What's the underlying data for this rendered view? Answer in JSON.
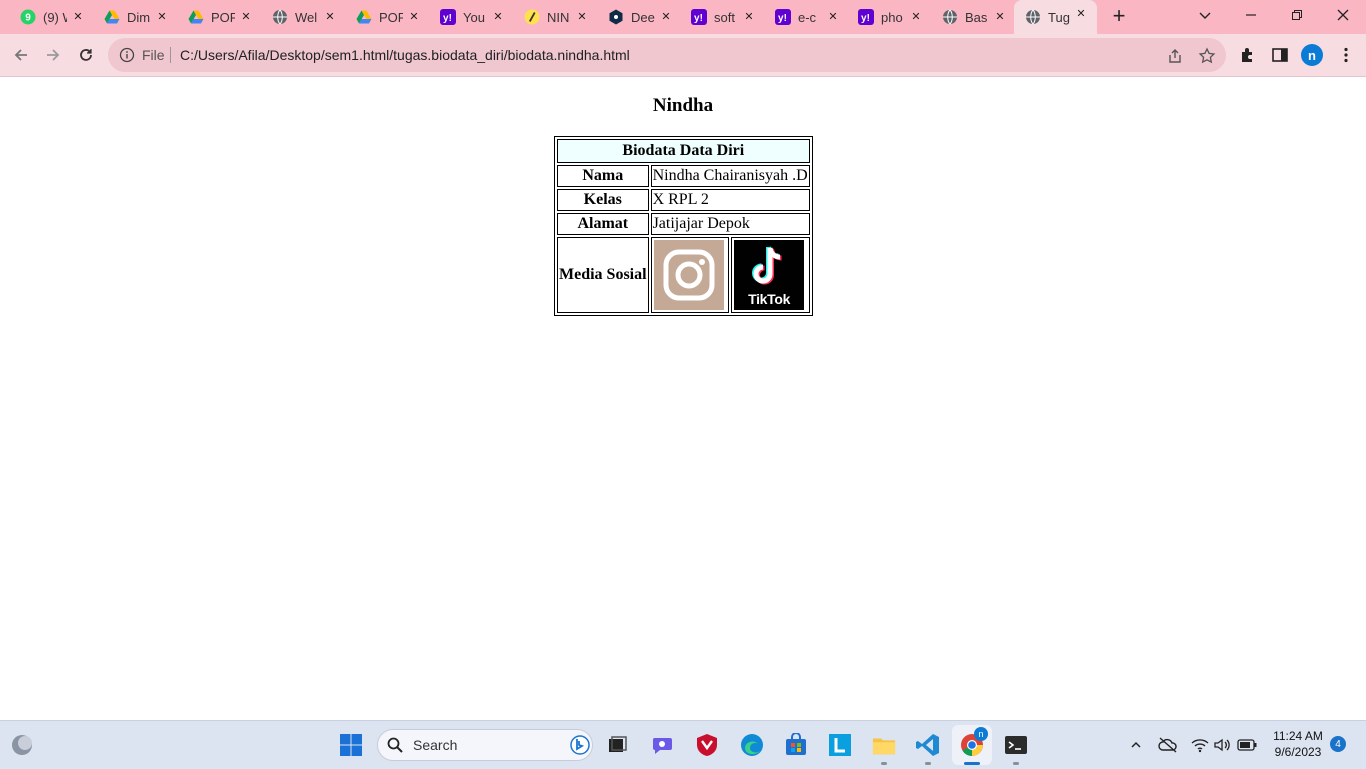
{
  "browser": {
    "tabs": [
      {
        "title": "(9) W",
        "icon": "whatsapp-icon",
        "active": false
      },
      {
        "title": "Dim",
        "icon": "google-drive-icon",
        "active": false
      },
      {
        "title": "POF",
        "icon": "google-drive-icon",
        "active": false
      },
      {
        "title": "Wel",
        "icon": "globe-icon",
        "active": false
      },
      {
        "title": "POF",
        "icon": "google-drive-icon",
        "active": false
      },
      {
        "title": "You",
        "icon": "yahoo-icon",
        "active": false
      },
      {
        "title": "NIN",
        "icon": "pencil-icon",
        "active": false
      },
      {
        "title": "Dee",
        "icon": "deepl-icon",
        "active": false
      },
      {
        "title": "soft",
        "icon": "yahoo-icon",
        "active": false
      },
      {
        "title": "e-c",
        "icon": "yahoo-icon",
        "active": false
      },
      {
        "title": "pho",
        "icon": "yahoo-icon",
        "active": false
      },
      {
        "title": "Bas",
        "icon": "globe-icon",
        "active": false
      },
      {
        "title": "Tug",
        "icon": "globe-icon",
        "active": true
      }
    ],
    "omnibox": {
      "scheme_label": "File",
      "url": "C:/Users/Afila/Desktop/sem1.html/tugas.biodata_diri/biodata.nindha.html"
    },
    "profile_initial": "n",
    "colors": {
      "tabstrip": "#fbb6c4",
      "toolbar": "#f7dde2",
      "omnibox": "#f0c6cf"
    }
  },
  "page": {
    "heading": "Nindha",
    "table": {
      "title": "Biodata Data Diri",
      "rows": [
        {
          "label": "Nama",
          "value": "Nindha Chairanisyah .D"
        },
        {
          "label": "Kelas",
          "value": "X RPL 2"
        },
        {
          "label": "Alamat",
          "value": "Jatijajar Depok"
        }
      ],
      "social_label": "Media Sosial",
      "social": [
        {
          "name": "instagram",
          "icon": "instagram-icon"
        },
        {
          "name": "tiktok",
          "icon": "tiktok-icon",
          "label": "TikTok"
        }
      ]
    }
  },
  "taskbar": {
    "search_placeholder": "Search",
    "time": "11:24 AM",
    "date": "9/6/2023",
    "notification_count": "4",
    "chrome_badge": "n"
  }
}
